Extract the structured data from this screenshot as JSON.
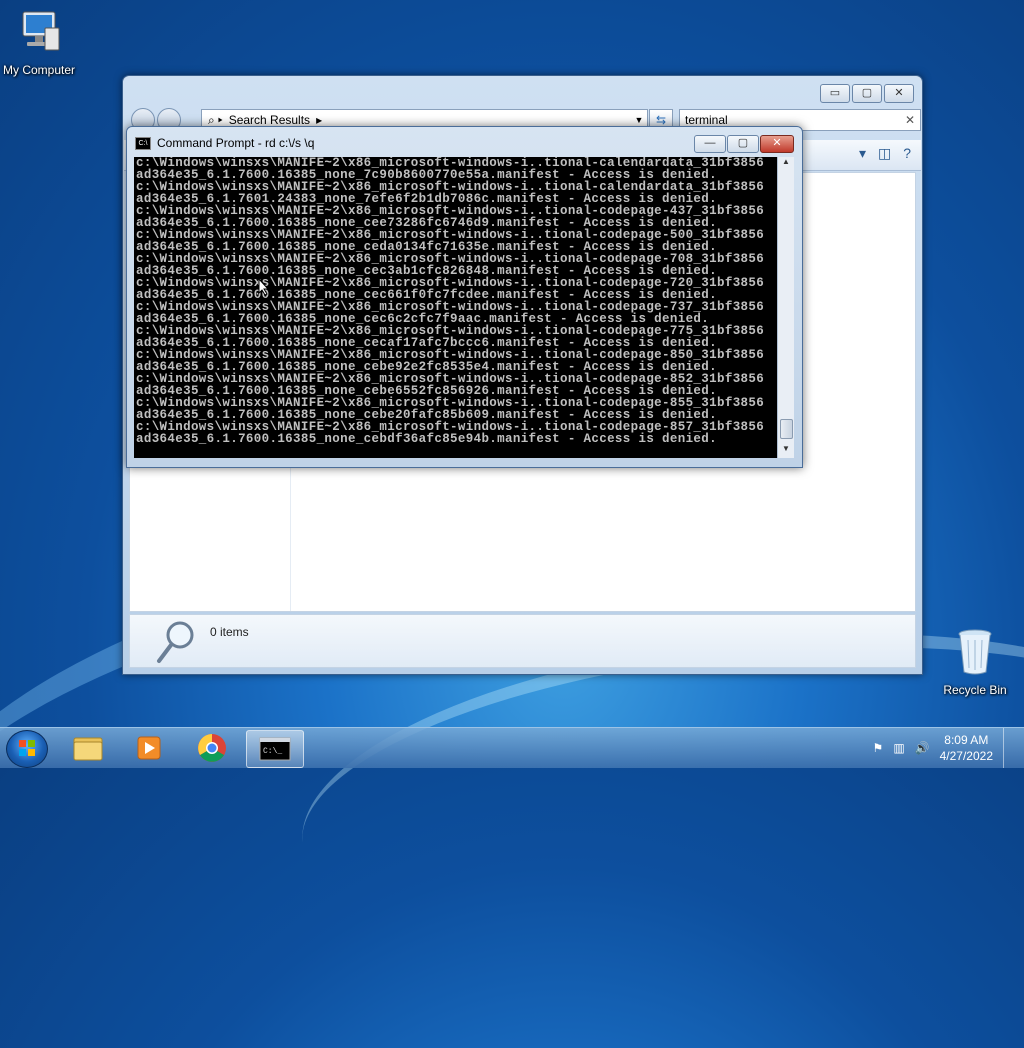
{
  "desktop": {
    "my_computer_label": "My Computer",
    "recycle_bin_label": "Recycle Bin"
  },
  "explorer": {
    "breadcrumb": "Search Results",
    "search_value": "terminal",
    "item_count": "0 items",
    "ctrl_min": "▭",
    "ctrl_max": "▢",
    "ctrl_close": "✕"
  },
  "cmd": {
    "title": "Command Prompt - rd  c:\\/s \\q",
    "icon_text": "C:\\",
    "output": "c:\\Windows\\winsxs\\MANIFE~2\\x86_microsoft-windows-i..tional-calendardata_31bf3856\nad364e35_6.1.7600.16385_none_7c90b8600770e55a.manifest - Access is denied.\nc:\\Windows\\winsxs\\MANIFE~2\\x86_microsoft-windows-i..tional-calendardata_31bf3856\nad364e35_6.1.7601.24383_none_7efe6f2b1db7086c.manifest - Access is denied.\nc:\\Windows\\winsxs\\MANIFE~2\\x86_microsoft-windows-i..tional-codepage-437_31bf3856\nad364e35_6.1.7600.16385_none_cee73286fc6746d9.manifest - Access is denied.\nc:\\Windows\\winsxs\\MANIFE~2\\x86_microsoft-windows-i..tional-codepage-500_31bf3856\nad364e35_6.1.7600.16385_none_ceda0134fc71635e.manifest - Access is denied.\nc:\\Windows\\winsxs\\MANIFE~2\\x86_microsoft-windows-i..tional-codepage-708_31bf3856\nad364e35_6.1.7600.16385_none_cec3ab1cfc826848.manifest - Access is denied.\nc:\\Windows\\winsxs\\MANIFE~2\\x86_microsoft-windows-i..tional-codepage-720_31bf3856\nad364e35_6.1.7600.16385_none_cec661f0fc7fcdee.manifest - Access is denied.\nc:\\Windows\\winsxs\\MANIFE~2\\x86_microsoft-windows-i..tional-codepage-737_31bf3856\nad364e35_6.1.7600.16385_none_cec6c2cfc7f9aac.manifest - Access is denied.\nc:\\Windows\\winsxs\\MANIFE~2\\x86_microsoft-windows-i..tional-codepage-775_31bf3856\nad364e35_6.1.7600.16385_none_cecaf17afc7bccc6.manifest - Access is denied.\nc:\\Windows\\winsxs\\MANIFE~2\\x86_microsoft-windows-i..tional-codepage-850_31bf3856\nad364e35_6.1.7600.16385_none_cebe92e2fc8535e4.manifest - Access is denied.\nc:\\Windows\\winsxs\\MANIFE~2\\x86_microsoft-windows-i..tional-codepage-852_31bf3856\nad364e35_6.1.7600.16385_none_cebe6552fc856926.manifest - Access is denied.\nc:\\Windows\\winsxs\\MANIFE~2\\x86_microsoft-windows-i..tional-codepage-855_31bf3856\nad364e35_6.1.7600.16385_none_cebe20fafc85b609.manifest - Access is denied.\nc:\\Windows\\winsxs\\MANIFE~2\\x86_microsoft-windows-i..tional-codepage-857_31bf3856\nad364e35_6.1.7600.16385_none_cebdf36afc85e94b.manifest - Access is denied.",
    "ctrl_min": "—",
    "ctrl_max": "▢",
    "ctrl_close": "✕"
  },
  "taskbar": {
    "time": "8:09 AM",
    "date": "4/27/2022"
  },
  "icons": {
    "my_computer": "computer-icon",
    "recycle_bin": "recycle-bin-icon",
    "start": "windows-logo-icon",
    "explorer": "folder-icon",
    "media": "media-player-icon",
    "chrome": "chrome-icon",
    "cmd": "cmd-icon"
  },
  "colors": {
    "console_bg": "#000000",
    "console_fg": "#c0c0c0",
    "close_red": "#c0392b"
  }
}
